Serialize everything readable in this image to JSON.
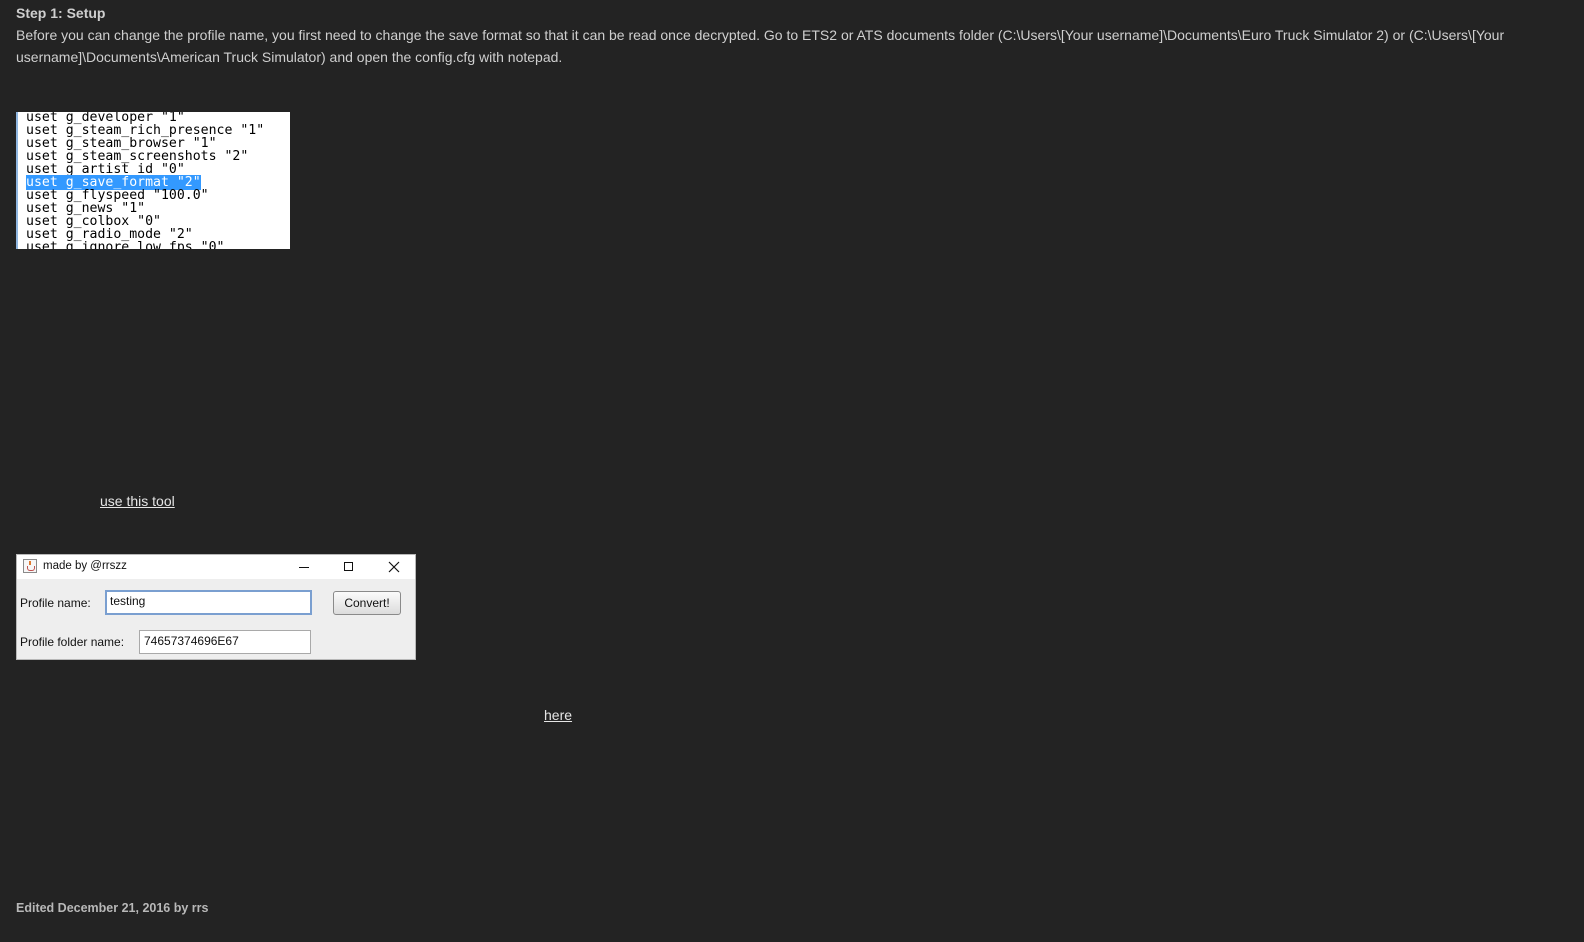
{
  "step1": {
    "heading": "Step 1: Setup",
    "body": "Before you can change the profile name, you first need to change the save format so that it can be read once decrypted.  Go to ETS2 or ATS documents folder (C:\\Users\\[Your username]\\Documents\\Euro Truck Simulator 2) or (C:\\Users\\[Your username]\\Documents\\American Truck Simulator) and open the config.cfg with notepad."
  },
  "config_lines": [
    {
      "text": "uset g_developer \"1\"",
      "selected": false
    },
    {
      "text": "uset g_steam_rich_presence \"1\"",
      "selected": false
    },
    {
      "text": "uset g_steam_browser \"1\"",
      "selected": false
    },
    {
      "text": "uset g_steam_screenshots \"2\"",
      "selected": false
    },
    {
      "text": "uset g_artist_id \"0\"",
      "selected": false
    },
    {
      "text": "uset g_save_format \"2\"",
      "selected": true
    },
    {
      "text": "uset g_flyspeed \"100.0\"",
      "selected": false
    },
    {
      "text": "uset g_news \"1\"",
      "selected": false
    },
    {
      "text": "uset g_colbox \"0\"",
      "selected": false
    },
    {
      "text": "uset g_radio_mode \"2\"",
      "selected": false
    },
    {
      "text": "uset g_ignore_low_fps \"0\"",
      "selected": false
    }
  ],
  "step3": {
    "link_text": "use this tool"
  },
  "tool_window": {
    "title": "made by @rrszz",
    "profile_name_label": "Profile name:",
    "profile_name_value": "testing",
    "convert_label": "Convert!",
    "folder_name_label": "Profile folder name:",
    "folder_name_value": "74657374696E67"
  },
  "step4": {
    "link_text": "here"
  },
  "footer": {
    "edited": "Edited December 21, 2016 by rrs"
  }
}
